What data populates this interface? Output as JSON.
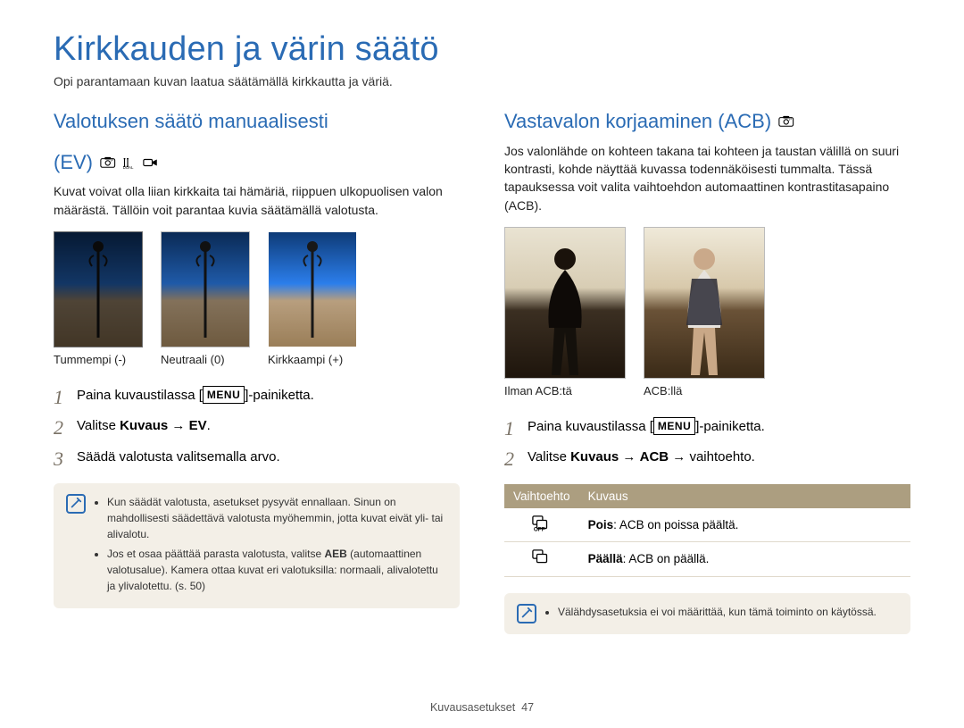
{
  "page": {
    "title": "Kirkkauden ja värin säätö",
    "subtitle": "Opi parantamaan kuvan laatua säätämällä kirkkautta ja väriä.",
    "footer_label": "Kuvausasetukset",
    "footer_page": "47"
  },
  "left": {
    "heading_line1": "Valotuksen säätö manuaalisesti",
    "heading_line2": "(EV)",
    "mode_icons": [
      "program-icon",
      "dual-is-icon",
      "movie-icon"
    ],
    "body": "Kuvat voivat olla liian kirkkaita tai hämäriä, riippuen ulkopuolisen valon määrästä. Tällöin voit parantaa kuvia säätämällä valotusta.",
    "captions": [
      "Tummempi (-)",
      "Neutraali (0)",
      "Kirkkaampi (+)"
    ],
    "steps": {
      "s1_pre": "Paina kuvaustilassa [",
      "s1_menu": "MENU",
      "s1_post": "]-painiketta.",
      "s2_pre": "Valitse ",
      "s2_b1": "Kuvaus",
      "s2_arrow": " → ",
      "s2_b2": "EV",
      "s2_post": ".",
      "s3": "Säädä valotusta valitsemalla arvo."
    },
    "notes": {
      "n1_a": "Kun säädät valotusta, asetukset pysyvät ennallaan. Sinun on mahdollisesti säädettävä valotusta myöhemmin, jotta kuvat eivät yli- tai alivalotu.",
      "n2_a": "Jos et osaa päättää parasta valotusta, valitse ",
      "n2_b": "AEB",
      "n2_c": " (automaattinen valotusalue). Kamera ottaa kuvat eri valotuksilla: normaali, alivalotettu ja ylivalotettu. (s. 50)"
    }
  },
  "right": {
    "heading": "Vastavalon korjaaminen (ACB)",
    "mode_icons": [
      "program-icon"
    ],
    "body": "Jos valonlähde on kohteen takana tai kohteen ja taustan välillä on suuri kontrasti, kohde näyttää kuvassa todennäköisesti tummalta. Tässä tapauksessa voit valita vaihtoehdon automaattinen kontrastitasapaino (ACB).",
    "captions": [
      "Ilman ACB:tä",
      "ACB:llä"
    ],
    "steps": {
      "s1_pre": "Paina kuvaustilassa [",
      "s1_menu": "MENU",
      "s1_post": "]-painiketta.",
      "s2_pre": "Valitse ",
      "s2_b1": "Kuvaus",
      "s2_arrow1": " → ",
      "s2_b2": "ACB",
      "s2_arrow2": " → vaihtoehto."
    },
    "table": {
      "h1": "Vaihtoehto",
      "h2": "Kuvaus",
      "r1_icon": "acb-off-icon",
      "r1_b": "Pois",
      "r1_t": ": ACB on poissa päältä.",
      "r2_icon": "acb-on-icon",
      "r2_b": "Päällä",
      "r2_t": ": ACB on päällä."
    },
    "note": "Välähdysasetuksia ei voi määrittää, kun tämä toiminto on käytössä."
  }
}
